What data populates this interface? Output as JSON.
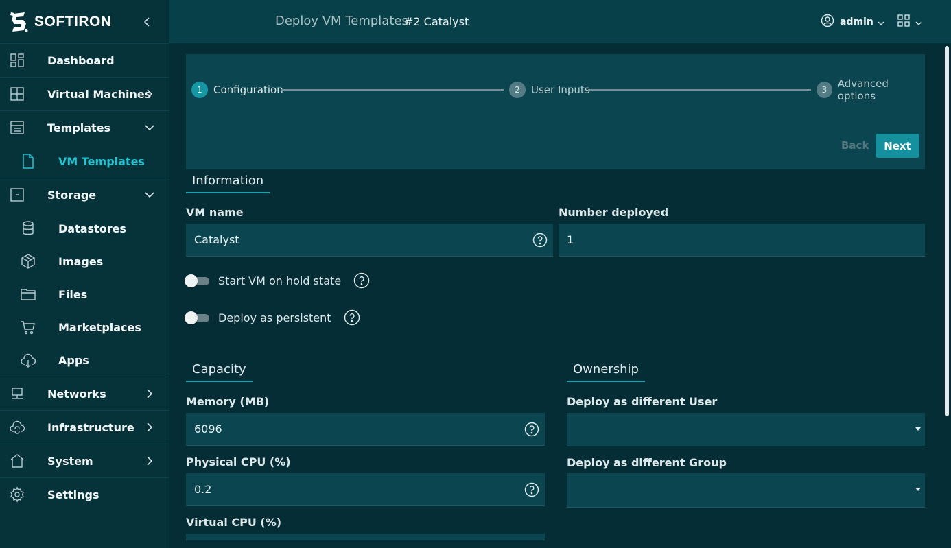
{
  "brand": {
    "name": "SOFTIRON"
  },
  "sidebar": {
    "items": [
      {
        "label": "Dashboard",
        "icon": "dashboard-icon"
      },
      {
        "label": "Virtual Machines",
        "icon": "grid-icon"
      },
      {
        "label": "Templates",
        "icon": "archive-icon"
      },
      {
        "label": "VM Templates",
        "icon": "file-icon"
      },
      {
        "label": "Storage",
        "icon": "storage-box-icon"
      },
      {
        "label": "Datastores",
        "icon": "database-icon"
      },
      {
        "label": "Images",
        "icon": "box-icon"
      },
      {
        "label": "Files",
        "icon": "folder-icon"
      },
      {
        "label": "Marketplaces",
        "icon": "cart-icon"
      },
      {
        "label": "Apps",
        "icon": "cloud-download-icon"
      },
      {
        "label": "Networks",
        "icon": "network-icon"
      },
      {
        "label": "Infrastructure",
        "icon": "cloud-sync-icon"
      },
      {
        "label": "System",
        "icon": "home-icon"
      },
      {
        "label": "Settings",
        "icon": "gear-icon"
      }
    ]
  },
  "header": {
    "title": "Deploy VM Templates",
    "subtitle": "#2 Catalyst",
    "user": "admin"
  },
  "stepper": {
    "steps": [
      {
        "number": "1",
        "label": "Configuration"
      },
      {
        "number": "2",
        "label": "User Inputs"
      },
      {
        "number": "3",
        "label": "Advanced options"
      }
    ],
    "back_label": "Back",
    "next_label": "Next"
  },
  "information": {
    "title": "Information",
    "vm_name_label": "VM name",
    "vm_name_value": "Catalyst",
    "number_deployed_label": "Number deployed",
    "number_deployed_value": "1",
    "hold_label": "Start VM on hold state",
    "persistent_label": "Deploy as persistent"
  },
  "capacity": {
    "title": "Capacity",
    "memory_label": "Memory (MB)",
    "memory_value": "6096",
    "pcpu_label": "Physical CPU (%)",
    "pcpu_value": "0.2",
    "vcpu_label": "Virtual CPU (%)"
  },
  "ownership": {
    "title": "Ownership",
    "user_label": "Deploy as different User",
    "group_label": "Deploy as different Group"
  },
  "colors": {
    "accent": "#1597a4",
    "active_nav": "#21c5d2",
    "background": "#052d35"
  }
}
